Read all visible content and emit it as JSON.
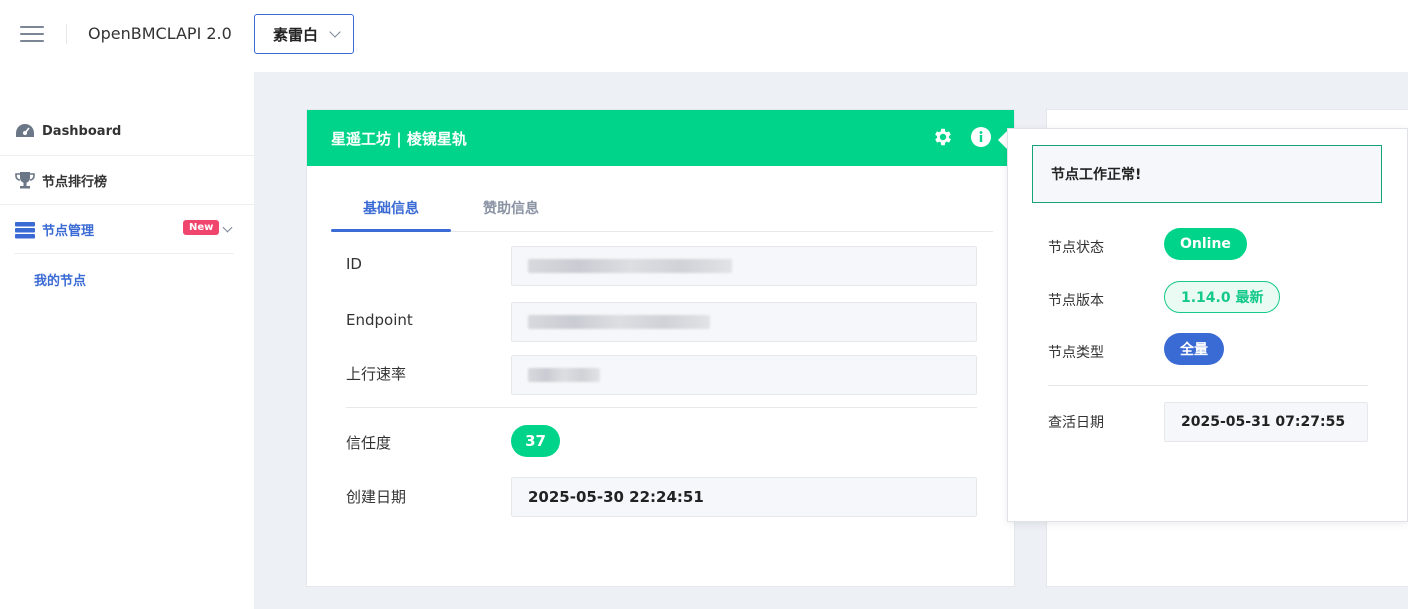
{
  "header": {
    "app_title": "OpenBMCLAPI 2.0",
    "user_selected": "素雷白"
  },
  "sidebar": {
    "items": [
      {
        "label": "Dashboard",
        "icon": "dashboard-gauge-icon"
      },
      {
        "label": "节点排行榜",
        "icon": "trophy-icon"
      },
      {
        "label": "节点管理",
        "icon": "server-icon",
        "badge": "New"
      }
    ],
    "sub_items": [
      {
        "label": "我的节点"
      }
    ]
  },
  "card": {
    "title": "星遥工坊 | 棱镜星轨",
    "icons": [
      "gear-icon",
      "info-icon"
    ],
    "tabs": [
      "基础信息",
      "赞助信息"
    ],
    "fields": {
      "id_label": "ID",
      "endpoint_label": "Endpoint",
      "upload_label": "上行速率",
      "trust_label": "信任度",
      "trust_value": "37",
      "created_label": "创建日期",
      "created_value": "2025-05-30 22:24:51"
    }
  },
  "popover": {
    "alert": "节点工作正常!",
    "status_label": "节点状态",
    "status_value": "Online",
    "version_label": "节点版本",
    "version_value": "1.14.0 最新",
    "type_label": "节点类型",
    "type_value": "全量",
    "check_label": "查活日期",
    "check_value": "2025-05-31 07:27:55"
  },
  "colors": {
    "accent_green": "#00d48a",
    "accent_blue": "#3a6ad4",
    "badge_pink": "#f0466e"
  }
}
